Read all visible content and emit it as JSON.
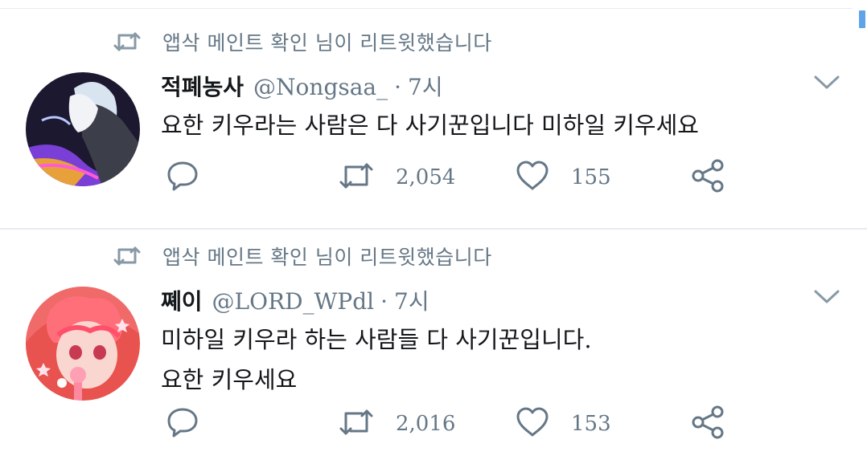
{
  "colors": {
    "accent": "#1da1f2",
    "muted": "#657786",
    "text": "#14171a",
    "divider": "#e6ecf0"
  },
  "tweets": [
    {
      "retweet_note": "앱삭 메인트 확인 님이 리트윗했습니다",
      "name": "적폐농사",
      "handle": "@Nongsaa_",
      "dot": "·",
      "time": "7시",
      "lines": [
        "요한 키우라는 사람은 다 사기꾼입니다 미하일 키우세요"
      ],
      "retweets": "2,054",
      "likes": "155",
      "icons": [
        "retweet-icon",
        "caret-down-icon",
        "reply-icon",
        "retweet-icon",
        "heart-icon",
        "share-icon"
      ]
    },
    {
      "retweet_note": "앱삭 메인트 확인 님이 리트윗했습니다",
      "name": "쪠이",
      "handle": "@LORD_WPdl",
      "dot": "·",
      "time": "7시",
      "lines": [
        "미하일 키우라 하는 사람들 다 사기꾼입니다.",
        "요한 키우세요"
      ],
      "retweets": "2,016",
      "likes": "153",
      "icons": [
        "retweet-icon",
        "caret-down-icon",
        "reply-icon",
        "retweet-icon",
        "heart-icon",
        "share-icon"
      ]
    }
  ]
}
